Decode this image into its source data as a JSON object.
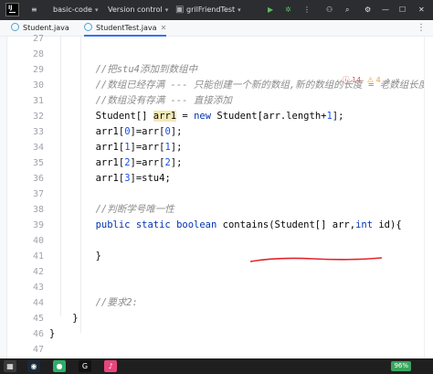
{
  "app": {
    "logo_text": "IJ"
  },
  "titlebar": {
    "project": "basic-code",
    "vcs": "Version control",
    "run_config": "grilFriendTest"
  },
  "tabs": [
    {
      "label": "Student.java",
      "active": false
    },
    {
      "label": "StudentTest.java",
      "active": true
    }
  ],
  "inspections": {
    "errors": "14",
    "warnings": "4"
  },
  "editor": {
    "lines": [
      {
        "n": "27",
        "html": ""
      },
      {
        "n": "28",
        "html": ""
      },
      {
        "n": "29",
        "html": "        <span class=\"cm\">//把stu4添加到数组中</span>"
      },
      {
        "n": "30",
        "html": "        <span class=\"cm\">//数组已经存满 --- 只能创建一个新的数组,新的数组的长度 = 老数组长度</span>"
      },
      {
        "n": "31",
        "html": "        <span class=\"cm\">//数组没有存满 --- 直接添加</span>"
      },
      {
        "n": "32",
        "html": "        Student[] <span class=\"var1\">arr1</span> = <span class=\"kw\">new</span> Student[arr.length+<span class=\"num\">1</span>];"
      },
      {
        "n": "33",
        "html": "        arr1[<span class=\"num\">0</span>]=arr[<span class=\"num\">0</span>];"
      },
      {
        "n": "34",
        "html": "        arr1[<span class=\"num\">1</span>]=arr[<span class=\"num\">1</span>];"
      },
      {
        "n": "35",
        "html": "        arr1[<span class=\"num\">2</span>]=arr[<span class=\"num\">2</span>];"
      },
      {
        "n": "36",
        "html": "        arr1[<span class=\"num\">3</span>]=stu4;"
      },
      {
        "n": "37",
        "html": ""
      },
      {
        "n": "38",
        "html": "        <span class=\"cm\">//判断学号唯一性</span>"
      },
      {
        "n": "39",
        "html": "        <span class=\"kw\">public static boolean</span> contains(Student[] arr,<span class=\"kw\">int</span> id){"
      },
      {
        "n": "40",
        "html": ""
      },
      {
        "n": "41",
        "html": "        }"
      },
      {
        "n": "42",
        "html": ""
      },
      {
        "n": "43",
        "html": ""
      },
      {
        "n": "44",
        "html": "        <span class=\"cm\">//要求2:</span>"
      },
      {
        "n": "45",
        "html": "    }"
      },
      {
        "n": "46",
        "html": "}"
      },
      {
        "n": "47",
        "html": ""
      }
    ]
  },
  "status": {
    "battery": "96%"
  },
  "taskbar": [
    {
      "name": "steam-icon",
      "glyph": "◉",
      "color": "#1b2838"
    },
    {
      "name": "wechat-icon",
      "glyph": "●",
      "color": "#2aae67"
    },
    {
      "name": "pycharm-icon",
      "glyph": "G",
      "color": "#111111"
    },
    {
      "name": "music-app-icon",
      "glyph": "♪",
      "color": "#e8457a"
    }
  ]
}
